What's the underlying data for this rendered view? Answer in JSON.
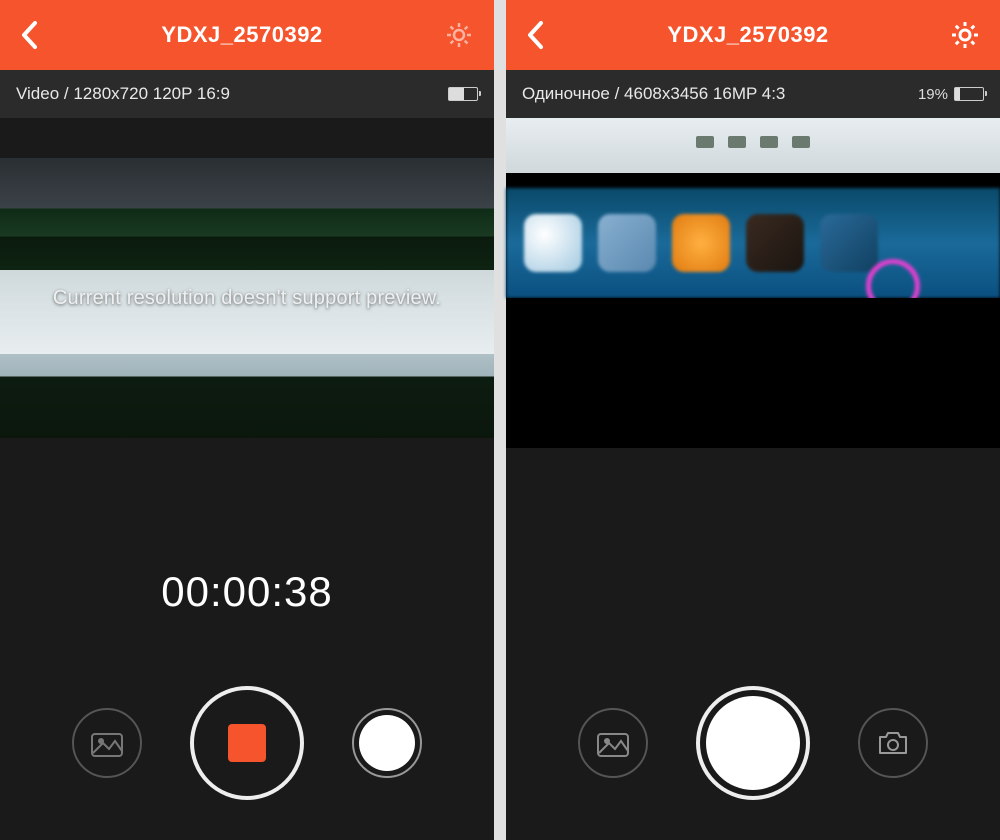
{
  "colors": {
    "accent": "#f5542d"
  },
  "left": {
    "header": {
      "title": "YDXJ_2570392"
    },
    "info": {
      "mode_line": "Video / 1280x720 120P 16:9"
    },
    "overlay": {
      "message": "Current resolution doesn't support preview."
    },
    "timer": "00:00:38",
    "icons": {
      "back": "back-chevron",
      "settings": "gear-icon",
      "gallery": "photo-icon",
      "record": "stop-record",
      "mode": "mode-switch"
    }
  },
  "right": {
    "header": {
      "title": "YDXJ_2570392"
    },
    "info": {
      "mode_line": "Одиночное / 4608x3456 16MP 4:3",
      "battery_pct": "19%"
    },
    "icons": {
      "back": "back-chevron",
      "settings": "gear-icon",
      "gallery": "photo-icon",
      "shutter": "shutter",
      "mode": "camera-mode"
    }
  }
}
